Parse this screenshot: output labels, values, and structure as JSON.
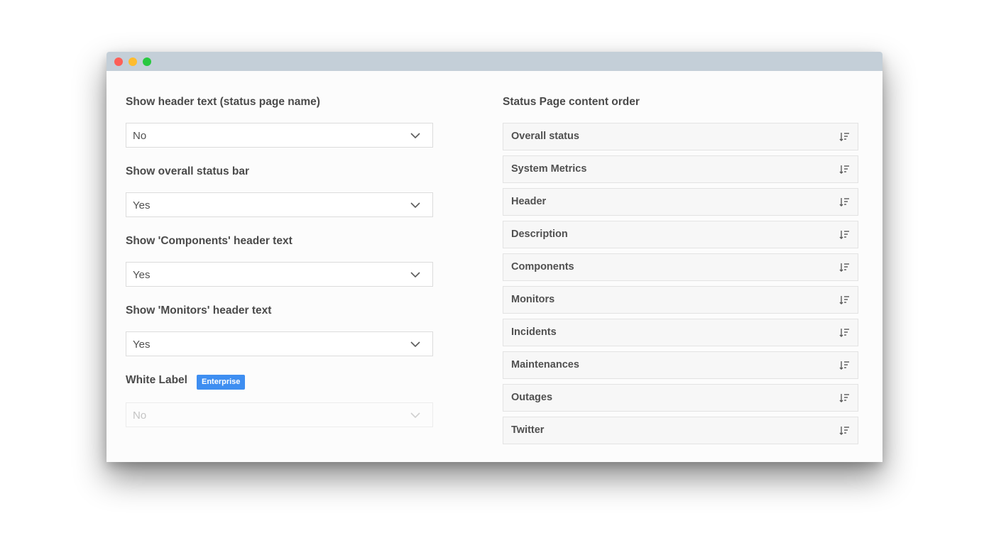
{
  "left_panel": {
    "fields": [
      {
        "label": "Show header text (status page name)",
        "value": "No"
      },
      {
        "label": "Show overall status bar",
        "value": "Yes"
      },
      {
        "label": "Show 'Components' header text",
        "value": "Yes"
      },
      {
        "label": "Show 'Monitors' header text",
        "value": "Yes"
      }
    ],
    "white_label": {
      "label": "White Label",
      "badge": "Enterprise",
      "value": "No"
    }
  },
  "right_panel": {
    "title": "Status Page content order",
    "items": [
      "Overall status",
      "System Metrics",
      "Header",
      "Description",
      "Components",
      "Monitors",
      "Incidents",
      "Maintenances",
      "Outages",
      "Twitter"
    ]
  },
  "colors": {
    "titlebar": "#c4cfd8",
    "close": "#fd5f57",
    "minimize": "#febc2e",
    "maximize": "#28c840",
    "badge": "#3e8ef1"
  },
  "icons": {
    "select_arrow": "chevron-down-icon",
    "reorder": "sort-icon"
  }
}
